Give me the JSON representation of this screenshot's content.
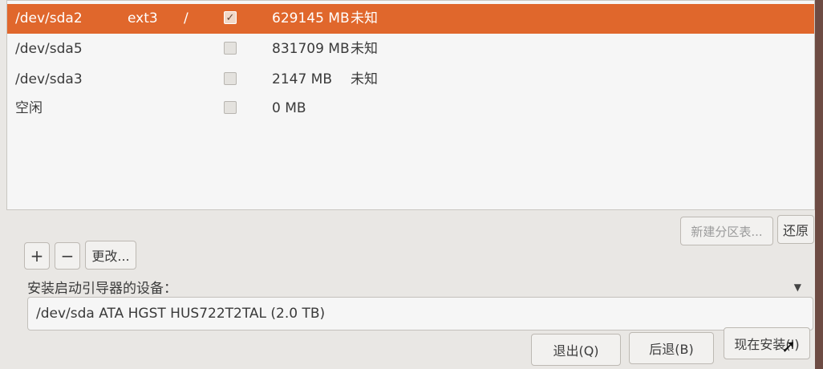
{
  "partitions": [
    {
      "device": "/dev/sda2",
      "type": "ext3",
      "mount": "/",
      "format": true,
      "size": "629145 MB",
      "used": "未知",
      "selected": true
    },
    {
      "device": "/dev/sda5",
      "type": "",
      "mount": "",
      "format": false,
      "size": "831709 MB",
      "used": "未知",
      "selected": false
    },
    {
      "device": "/dev/sda3",
      "type": "",
      "mount": "",
      "format": false,
      "size": "2147 MB",
      "used": "未知",
      "selected": false
    },
    {
      "device": "空闲",
      "type": "",
      "mount": "",
      "format": false,
      "size": "0 MB",
      "used": "",
      "selected": false
    }
  ],
  "toolbar": {
    "add_label": "+",
    "remove_label": "−",
    "change_label": "更改...",
    "new_table_label": "新建分区表...",
    "revert_label": "还原"
  },
  "bootloader": {
    "label": "安装启动引导器的设备：",
    "value": "/dev/sda   ATA HGST HUS722T2TAL (2.0 TB)"
  },
  "footer": {
    "quit_label": "退出(Q)",
    "back_label": "后退(B)",
    "install_label": "现在安装(I)"
  },
  "colors": {
    "accent": "#e0672c"
  }
}
